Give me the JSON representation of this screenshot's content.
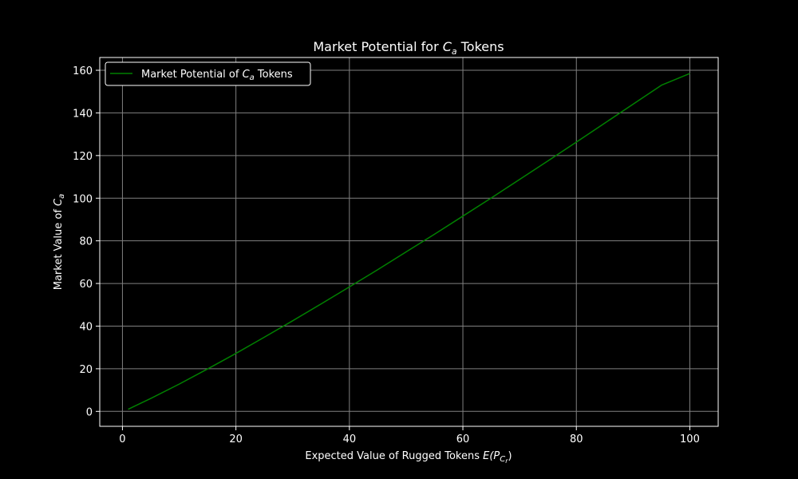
{
  "chart_data": {
    "type": "line",
    "title": {
      "pre": "Market Potential for ",
      "math": "C",
      "sub": "a",
      "post": " Tokens"
    },
    "xlabel": {
      "pre": "Expected Value of Rugged Tokens ",
      "math": "E(P",
      "sub": "C",
      "subsub": "r",
      "post": ")"
    },
    "ylabel": {
      "pre": "Market Value of ",
      "math": "C",
      "sub": "a"
    },
    "xlim": [
      -4,
      105
    ],
    "ylim": [
      -7,
      166
    ],
    "xticks": [
      0,
      20,
      40,
      60,
      80,
      100
    ],
    "yticks": [
      0,
      20,
      40,
      60,
      80,
      100,
      120,
      140,
      160
    ],
    "grid": true,
    "legend_position": "upper-left",
    "series": [
      {
        "name": {
          "pre": "Market Potential of ",
          "math": "C",
          "sub": "a",
          "post": " Tokens"
        },
        "color": "#008000",
        "x": [
          1,
          5,
          10,
          15,
          20,
          25,
          30,
          35,
          40,
          45,
          50,
          55,
          60,
          65,
          70,
          75,
          80,
          85,
          90,
          95,
          100
        ],
        "y": [
          1,
          6.1,
          12.8,
          19.9,
          27.2,
          34.8,
          42.5,
          50.4,
          58.4,
          66.5,
          74.8,
          83.1,
          91.6,
          100.1,
          108.8,
          117.5,
          126.3,
          135.2,
          144.1,
          153.0,
          158.5
        ]
      }
    ]
  },
  "style": {
    "background": "#000000",
    "axes_edge": "#ffffff",
    "grid_color": "#808080",
    "text_color": "#ffffff",
    "legend_bg": "#000000",
    "legend_edge": "#ffffff"
  }
}
